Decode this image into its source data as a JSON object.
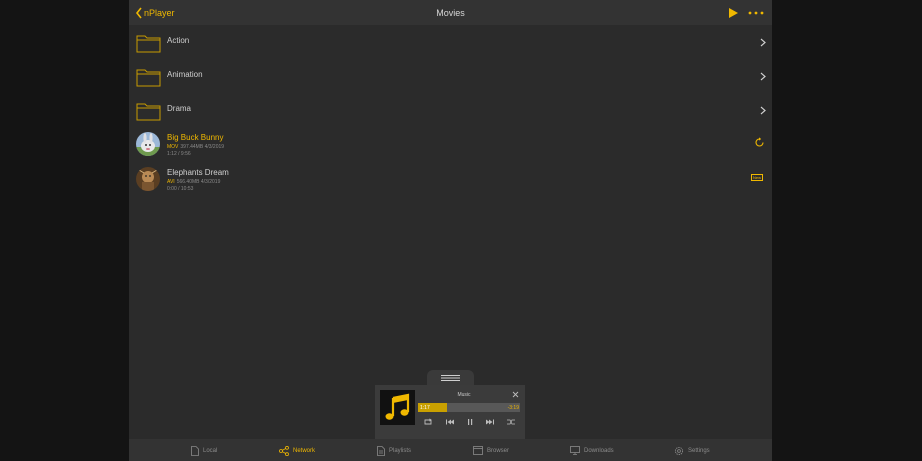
{
  "header": {
    "back_label": "nPlayer",
    "title": "Movies",
    "play_icon": "play-icon",
    "more_icon": "more-icon"
  },
  "folders": [
    {
      "label": "Action"
    },
    {
      "label": "Animation"
    },
    {
      "label": "Drama"
    }
  ],
  "media": [
    {
      "title": "Big Buck Bunny",
      "format": "MOV",
      "size": "397.44MB",
      "date": "4/3/2019",
      "progress": "1:12 / 9:56",
      "status": "resume"
    },
    {
      "title": "Elephants Dream",
      "format": "AVI",
      "size": "566.40MB",
      "date": "4/3/2019",
      "progress": "0:00 / 10:53",
      "status": "New"
    }
  ],
  "mini_player": {
    "title": "Music",
    "elapsed": "1:17",
    "remaining": "-3:19",
    "progress_fraction": 0.28,
    "artwork_icon": "music-note-icon"
  },
  "tabs": [
    {
      "label": "Local",
      "icon": "file-icon",
      "active": false
    },
    {
      "label": "Network",
      "icon": "share-icon",
      "active": true
    },
    {
      "label": "Playlists",
      "icon": "document-icon",
      "active": false
    },
    {
      "label": "Browser",
      "icon": "browser-icon",
      "active": false
    },
    {
      "label": "Downloads",
      "icon": "download-icon",
      "active": false
    },
    {
      "label": "Settings",
      "icon": "gear-icon",
      "active": false
    }
  ],
  "colors": {
    "accent": "#f0b800",
    "background": "#2b2b2b",
    "bar": "#333333"
  }
}
